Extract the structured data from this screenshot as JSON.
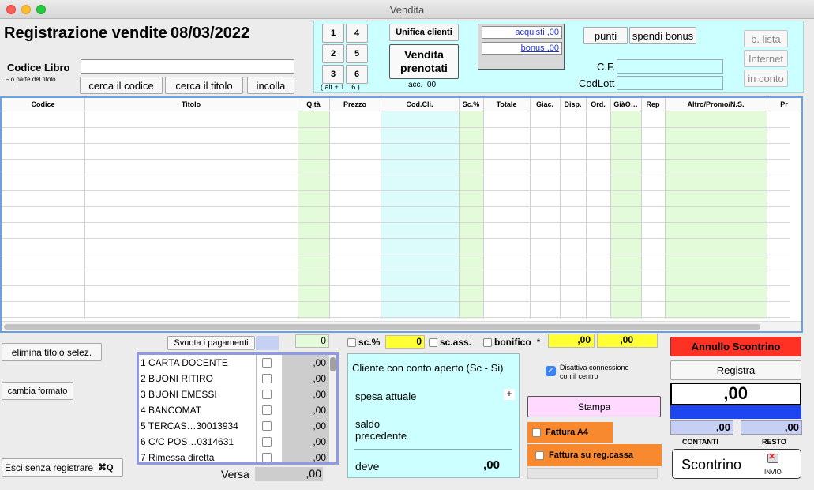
{
  "window": {
    "title": "Vendita"
  },
  "header": {
    "title": "Registrazione vendite",
    "date": "08/03/2022"
  },
  "codice": {
    "label": "Codice Libro",
    "sublabel": "– o parte del  titolo",
    "value": "",
    "search_code": "cerca il codice",
    "search_title": "cerca il titolo",
    "paste": "incolla"
  },
  "keypad": {
    "keys": [
      "1",
      "4",
      "2",
      "5",
      "3",
      "6"
    ],
    "hint": "( alt + 1…6 )"
  },
  "unifica": "Unifica clienti",
  "vendita_prenotati": {
    "line1": "Vendita",
    "line2": "prenotati",
    "acc": "acc. ,00"
  },
  "acquisti": {
    "acquisti": "acquisti ,00",
    "bonus": "bonus ,00"
  },
  "punti": "punti",
  "spendi_bonus": "spendi bonus",
  "cf": {
    "label": "C.F.",
    "value": ""
  },
  "codlott": {
    "label": "CodLott",
    "value": ""
  },
  "side_buttons": [
    "b. lista",
    "Internet",
    "in conto"
  ],
  "table": {
    "columns": [
      "Codice",
      "Titolo",
      "Q.tà",
      "Prezzo",
      "Cod.Cli.",
      "Sc.%",
      "Totale",
      "Giac.",
      "Disp.",
      "Ord.",
      "GiàO…",
      "Rep",
      "Altro/Promo/N.S.",
      "Pr"
    ]
  },
  "actions": {
    "elimina": "elimina titolo selez.",
    "cambia": "cambia formato",
    "esci": "Esci senza registrare",
    "esci_icon": "⌘Q"
  },
  "pagamenti": {
    "svuota": "Svuota i pagamenti",
    "qty_total": "0",
    "items": [
      {
        "label": "1 CARTA DOCENTE",
        "value": ",00"
      },
      {
        "label": "2 BUONI RITIRO",
        "value": ",00"
      },
      {
        "label": "3 BUONI EMESSI",
        "value": ",00"
      },
      {
        "label": "4 BANCOMAT",
        "value": ",00"
      },
      {
        "label": "5 TERCAS…30013934",
        "value": ",00"
      },
      {
        "label": "6 C/C POS…0314631",
        "value": ",00"
      },
      {
        "label": "7 Rimessa diretta",
        "value": ",00"
      }
    ],
    "versa_label": "Versa",
    "versa_value": ",00"
  },
  "sconti": {
    "sc_pct": "sc.%",
    "sc_pct_value": "0",
    "sc_ass": "sc.ass.",
    "bonifico": "bonifico",
    "bonifico_star": "*",
    "val1": ",00",
    "val2": ",00"
  },
  "cliente": {
    "title": "Cliente con conto aperto (Sc - Si)",
    "spesa": "spesa attuale",
    "plus": "+",
    "saldo": "saldo\nprecedente",
    "deve": "deve",
    "deve_value": ",00"
  },
  "connessione": {
    "label": "Disattiva connessione con il centro",
    "checked": true
  },
  "stampa": "Stampa",
  "fattura_a4": "Fattura A4",
  "fattura_reg": "Fattura su reg.cassa",
  "right": {
    "annullo": "Annullo Scontrino",
    "registra": "Registra",
    "total": ",00",
    "contanti_value": ",00",
    "resto_value": ",00",
    "contanti_label": "CONTANTI",
    "resto_label": "RESTO",
    "scontrino": "Scontrino",
    "invio": "INVIO"
  },
  "colors": {
    "cyan": "#ccffff",
    "yellow": "#ffff33",
    "orange": "#f9892f",
    "red": "#ff3124",
    "blue": "#1e46f0",
    "pink": "#ffd9ff",
    "green_col": "#e3fbd8"
  }
}
